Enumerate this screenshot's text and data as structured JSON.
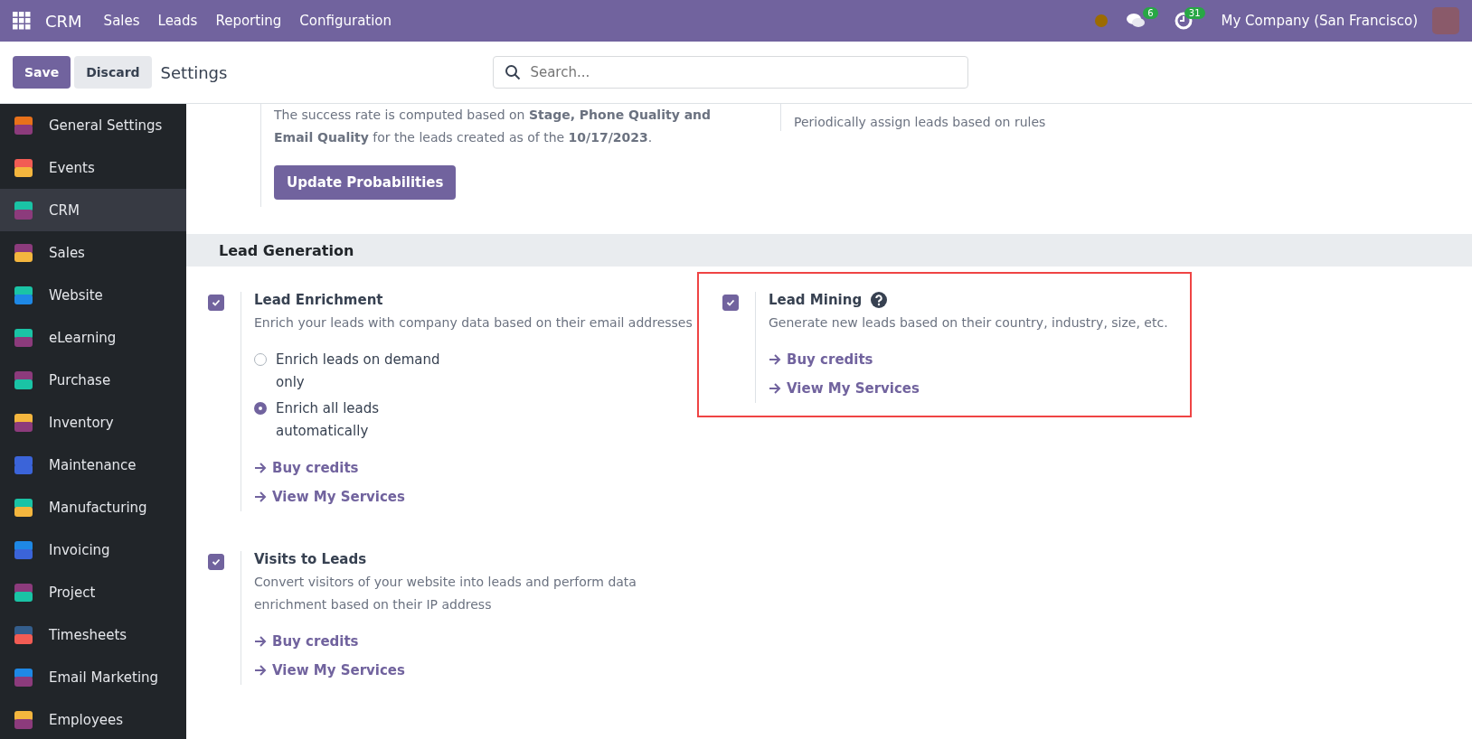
{
  "navbar": {
    "app": "CRM",
    "menus": [
      "Sales",
      "Leads",
      "Reporting",
      "Configuration"
    ],
    "messages_count": "6",
    "activities_count": "31",
    "company": "My Company (San Francisco)"
  },
  "control_panel": {
    "save": "Save",
    "discard": "Discard",
    "title": "Settings",
    "search": {
      "placeholder": "Search..."
    }
  },
  "sidebar": {
    "items": [
      {
        "label": "General Settings",
        "selected": false
      },
      {
        "label": "Events",
        "selected": false
      },
      {
        "label": "CRM",
        "selected": true
      },
      {
        "label": "Sales",
        "selected": false
      },
      {
        "label": "Website",
        "selected": false
      },
      {
        "label": "eLearning",
        "selected": false
      },
      {
        "label": "Purchase",
        "selected": false
      },
      {
        "label": "Inventory",
        "selected": false
      },
      {
        "label": "Maintenance",
        "selected": false
      },
      {
        "label": "Manufacturing",
        "selected": false
      },
      {
        "label": "Invoicing",
        "selected": false
      },
      {
        "label": "Project",
        "selected": false
      },
      {
        "label": "Timesheets",
        "selected": false
      },
      {
        "label": "Email Marketing",
        "selected": false
      },
      {
        "label": "Employees",
        "selected": false
      }
    ]
  },
  "top_settings": {
    "left": {
      "description": "The success rate is computed based on **Stage, Phone Quality and Email Quality** for the leads created as of the **10/17/2023**.",
      "button": "Update Probabilities"
    },
    "right": {
      "description": "Periodically assign leads based on rules"
    }
  },
  "section": {
    "title": "Lead Generation",
    "settings": [
      {
        "title": "Lead Enrichment",
        "checked": true,
        "help": false,
        "highlighted": false,
        "description": "Enrich your leads with company data based on their email addresses",
        "options": [
          {
            "label": "Enrich leads on demand only",
            "selected": false
          },
          {
            "label": "Enrich all leads automatically",
            "selected": true
          }
        ],
        "links": [
          "Buy credits",
          "View My Services"
        ]
      },
      {
        "title": "Lead Mining",
        "checked": true,
        "help": true,
        "highlighted": true,
        "description": "Generate new leads based on their country, industry, size, etc.",
        "links": [
          "Buy credits",
          "View My Services"
        ]
      },
      {
        "title": "Visits to Leads",
        "checked": true,
        "help": false,
        "highlighted": false,
        "description": "Convert visitors of your website into leads and perform data enrichment based on their IP address",
        "links": [
          "Buy credits",
          "View My Services"
        ]
      }
    ]
  }
}
